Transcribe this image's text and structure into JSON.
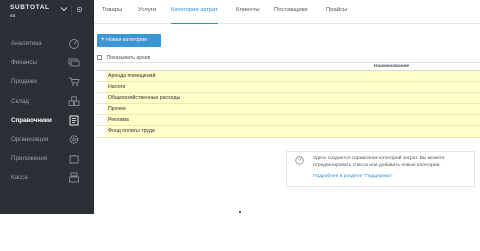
{
  "brand": {
    "name": "SUBTOTAL",
    "user": "s4"
  },
  "nav": {
    "items": [
      {
        "label": "Аналитика",
        "icon": "speedometer-icon",
        "active": false
      },
      {
        "label": "Финансы",
        "icon": "money-icon",
        "active": false
      },
      {
        "label": "Продажи",
        "icon": "cart-icon",
        "active": false
      },
      {
        "label": "Склад",
        "icon": "boxes-icon",
        "active": false
      },
      {
        "label": "Справочники",
        "icon": "book-icon",
        "active": true
      },
      {
        "label": "Организация",
        "icon": "gear-icon",
        "active": false
      },
      {
        "label": "Приложения",
        "icon": "puzzle-icon",
        "active": false
      },
      {
        "label": "Касса",
        "icon": "register-icon",
        "active": false
      }
    ]
  },
  "tabs": [
    {
      "label": "Товары",
      "active": false
    },
    {
      "label": "Услуги",
      "active": false
    },
    {
      "label": "Категории затрат",
      "active": true
    },
    {
      "label": "Клиенты",
      "active": false
    },
    {
      "label": "Поставщики",
      "active": false
    },
    {
      "label": "Прайсы",
      "active": false
    }
  ],
  "toolbar": {
    "new_category_label": "Новая категория"
  },
  "archive": {
    "label": "Показывать архив",
    "checked": false
  },
  "table": {
    "column_name": "Наименование",
    "rows": [
      "Аренда помещений",
      "Налоги",
      "Общехозяйственные расходы",
      "Прочее",
      "Реклама",
      "Фонд оплаты труда"
    ]
  },
  "info": {
    "text": "Здесь создается справочник категорий затрат. Вы можете отредактировать список или добавить новые категории.",
    "link": "Подробнее в разделе \"Поддержка\"."
  },
  "colors": {
    "accent": "#2d8fd1",
    "sidebar": "#2b2f36",
    "row_highlight": "#fffec8"
  }
}
